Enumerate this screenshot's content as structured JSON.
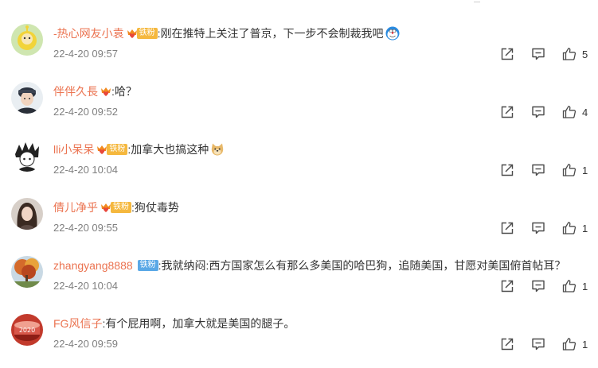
{
  "comments": [
    {
      "username": "-热心网友小袁",
      "badge": {
        "label": "铁粉",
        "color": "#f5b83e",
        "crown": true
      },
      "text": ":刚在推特上关注了普京，下一步不会制裁我吧",
      "emoji": "doraemon-emoji",
      "time": "22-4-20 09:57",
      "likes": "5",
      "avatar": "avatar-teletubby"
    },
    {
      "username": "伴伴久長",
      "badge": {
        "label": "",
        "color": "#f5b83e",
        "crown": true
      },
      "text": ":哈？",
      "emoji": "",
      "time": "22-4-20 09:52",
      "likes": "4",
      "avatar": "avatar-man-cap"
    },
    {
      "username": "lli小呆呆",
      "badge": {
        "label": "铁粉",
        "color": "#f5b83e",
        "crown": true
      },
      "text": ":加拿大也搞这种",
      "emoji": "doge-emoji",
      "time": "22-4-20 10:04",
      "likes": "1",
      "avatar": "avatar-anime-hair"
    },
    {
      "username": "倩儿净乎",
      "badge": {
        "label": "铁粉",
        "color": "#f5b83e",
        "crown": true
      },
      "text": ":狗仗毒势",
      "emoji": "",
      "time": "22-4-20 09:55",
      "likes": "1",
      "avatar": "avatar-woman"
    },
    {
      "username": "zhangyang8888",
      "badge": {
        "label": "铁粉",
        "color": "#5aa8e6",
        "crown": false
      },
      "text": ":我就纳闷:西方国家怎么有那么多美国的哈巴狗，追随美国，甘愿对美国俯首帖耳？",
      "emoji": "",
      "time": "22-4-20 10:04",
      "likes": "1",
      "avatar": "avatar-autumn-tree"
    },
    {
      "username": "FG风信子",
      "badge": null,
      "text": ":有个屁用啊，加拿大就是美国的腿子。",
      "emoji": "",
      "time": "22-4-20 09:59",
      "likes": "1",
      "avatar": "avatar-red-cake"
    }
  ],
  "colors": {
    "username": "#eb7350",
    "timestamp": "#808080",
    "icon": "#4a4a4a",
    "divider": "#eeeeee"
  },
  "icons": {
    "forward": "share-icon",
    "comment": "comment-icon",
    "like": "thumbs-up-icon"
  }
}
